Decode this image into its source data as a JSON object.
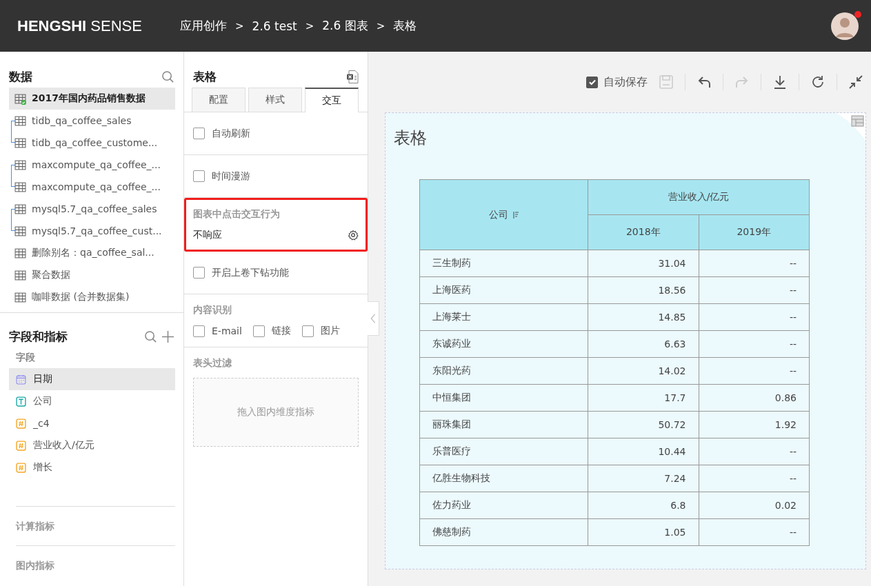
{
  "header": {
    "logo_bold": "HENGSHI",
    "logo_light": "SENSE",
    "breadcrumbs": [
      "应用创作",
      "2.6 test",
      "2.6 图表",
      "表格"
    ],
    "separator": ">",
    "has_notification": true
  },
  "data_panel": {
    "title": "数据",
    "items": [
      {
        "kind": "single",
        "name": "2017年国内药品销售数据",
        "selected": true
      },
      {
        "kind": "group",
        "items": [
          {
            "name": "tidb_qa_coffee_sales",
            "selected": false
          },
          {
            "name": "tidb_qa_coffee_custome...",
            "selected": false
          }
        ]
      },
      {
        "kind": "group",
        "items": [
          {
            "name": "maxcompute_qa_coffee_...",
            "selected": false
          },
          {
            "name": "maxcompute_qa_coffee_...",
            "selected": false
          }
        ]
      },
      {
        "kind": "group",
        "items": [
          {
            "name": "mysql5.7_qa_coffee_sales",
            "selected": false
          },
          {
            "name": "mysql5.7_qa_coffee_cust...",
            "selected": false
          }
        ]
      },
      {
        "kind": "single",
        "name": "删除别名：qa_coffee_sal...",
        "selected": false
      },
      {
        "kind": "single",
        "name": "聚合数据",
        "selected": false
      },
      {
        "kind": "single",
        "name": "咖啡数据 (合并数据集)",
        "selected": false
      }
    ]
  },
  "fields_panel": {
    "title": "字段和指标",
    "subtitle": "字段",
    "fields": [
      {
        "kind": "date",
        "name": "日期",
        "selected": true
      },
      {
        "kind": "text",
        "name": "公司",
        "selected": false
      },
      {
        "kind": "number",
        "name": "_c4",
        "selected": false
      },
      {
        "kind": "number",
        "name": "营业收入/亿元",
        "selected": false
      },
      {
        "kind": "number",
        "name": "增长",
        "selected": false
      }
    ],
    "sections": [
      "计算指标",
      "图内指标"
    ]
  },
  "settings": {
    "title": "表格",
    "tabs": [
      {
        "label": "配置",
        "selected": false
      },
      {
        "label": "样式",
        "selected": false
      },
      {
        "label": "交互",
        "selected": true
      }
    ],
    "options": [
      {
        "kind": "checkbox",
        "label": "自动刷新",
        "checked": false
      },
      {
        "kind": "checkbox",
        "label": "时间漫游",
        "checked": false
      },
      {
        "kind": "select",
        "label": "图表中点击交互行为",
        "value": "不响应",
        "highlighted": true
      },
      {
        "kind": "checkbox",
        "label": "开启上卷下钻功能",
        "checked": false
      },
      {
        "kind": "checkgroup",
        "label": "内容识别",
        "items": [
          {
            "label": "E-mail",
            "checked": false
          },
          {
            "label": "链接",
            "checked": false
          },
          {
            "label": "图片",
            "checked": false
          }
        ]
      },
      {
        "kind": "dropzone",
        "label": "表头过滤",
        "placeholder": "拖入图内维度指标"
      }
    ]
  },
  "toolbar": {
    "autosave": {
      "label": "自动保存",
      "checked": true
    },
    "buttons": [
      {
        "kind": "save",
        "disabled": true
      },
      {
        "kind": "undo",
        "disabled": false
      },
      {
        "kind": "redo",
        "disabled": true
      },
      {
        "kind": "download",
        "disabled": false
      },
      {
        "kind": "refresh",
        "disabled": false
      },
      {
        "kind": "collapse",
        "disabled": false
      }
    ]
  },
  "chart": {
    "title": "表格",
    "table": {
      "row_header": "公司",
      "group_header": "营业收入/亿元",
      "columns": [
        "",
        "2018年",
        "2019年"
      ],
      "rows": [
        [
          "三生制药",
          "31.04",
          "--"
        ],
        [
          "上海医药",
          "18.56",
          "--"
        ],
        [
          "上海莱士",
          "14.85",
          "--"
        ],
        [
          "东诚药业",
          "6.63",
          "--"
        ],
        [
          "东阳光药",
          "14.02",
          "--"
        ],
        [
          "中恒集团",
          "17.7",
          "0.86"
        ],
        [
          "丽珠集团",
          "50.72",
          "1.92"
        ],
        [
          "乐普医疗",
          "10.44",
          "--"
        ],
        [
          "亿胜生物科技",
          "7.24",
          "--"
        ],
        [
          "佐力药业",
          "6.8",
          "0.02"
        ],
        [
          "佛慈制药",
          "1.05",
          "--"
        ]
      ]
    }
  }
}
